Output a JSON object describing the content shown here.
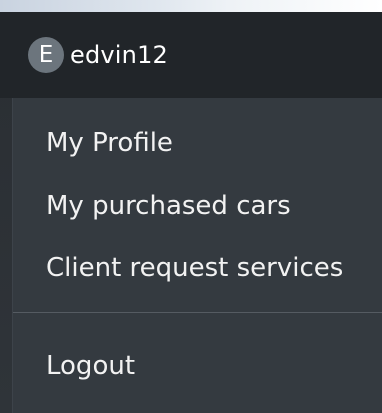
{
  "navbar": {
    "avatar_initial": "E",
    "username": "edvin12"
  },
  "menu": {
    "items": [
      {
        "label": "My Profile"
      },
      {
        "label": "My purchased cars"
      },
      {
        "label": "Client request services"
      }
    ],
    "logout_label": "Logout"
  },
  "colors": {
    "navbar_bg": "#212529",
    "dropdown_bg": "#343a40",
    "avatar_bg": "#6c757d",
    "text": "#ffffff"
  }
}
